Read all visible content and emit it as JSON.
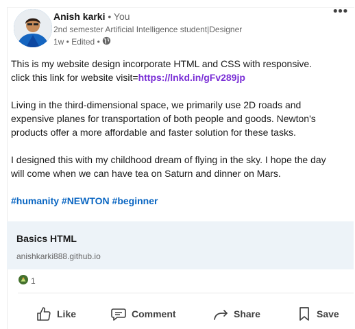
{
  "author": {
    "name": "Anish karki",
    "relation": " • You",
    "headline": "2nd semester Artificial Intelligence student|Designer",
    "meta": "1w • Edited •",
    "visibility_icon": "globe-icon"
  },
  "post": {
    "line1": "This is my website design incorporate HTML and CSS with responsive.",
    "link_prefix": "click this link for website visit=",
    "link": "https://lnkd.in/gFv289jp",
    "paragraph2": "Living in the third-dimensional space, we primarily use 2D roads and expensive planes for transportation of both people and goods. Newton's products offer a more affordable and faster solution for these tasks.",
    "paragraph3": "I designed this with my childhood dream of flying in the sky. I hope the day will come when we can have tea on Saturn and dinner on Mars.",
    "hashtags": "#humanity #NEWTON #beginner"
  },
  "preview": {
    "title": "Basics HTML",
    "domain": "anishkarki888.github.io"
  },
  "reactions": {
    "icon": "celebrate-icon",
    "count": "1"
  },
  "actions": {
    "like": "Like",
    "comment": "Comment",
    "share": "Share",
    "save": "Save"
  },
  "menu_label": "•••",
  "colors": {
    "link": "#7a2fd6",
    "hashtag": "#0a66c2",
    "preview_bg": "#edf3f8"
  }
}
